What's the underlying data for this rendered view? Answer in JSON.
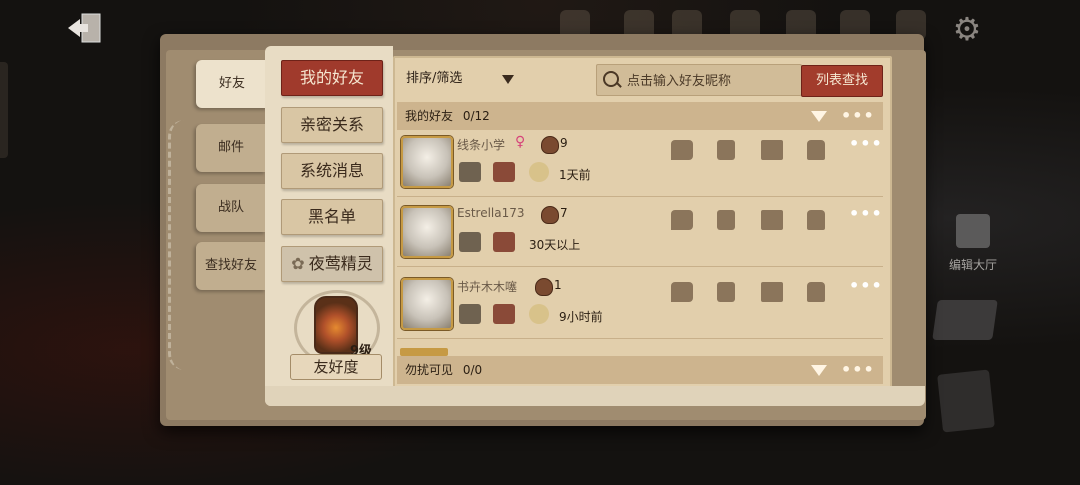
{
  "side_tabs": [
    {
      "label": "好友",
      "active": true
    },
    {
      "label": "邮件",
      "active": false
    },
    {
      "label": "战队",
      "active": false
    },
    {
      "label": "查找好友",
      "active": false
    }
  ],
  "menu": [
    {
      "label": "我的好友",
      "active": true
    },
    {
      "label": "亲密关系",
      "active": false
    },
    {
      "label": "系统消息",
      "active": false
    },
    {
      "label": "黑名单",
      "active": false
    },
    {
      "label": "夜莺精灵",
      "active": false
    }
  ],
  "friendliness": {
    "level": "9级",
    "label": "友好度"
  },
  "toolbar": {
    "sort_label": "排序/筛选",
    "search_placeholder": "点击输入好友昵称",
    "find_label": "列表查找"
  },
  "sections": [
    {
      "label": "我的好友",
      "count": "0/12",
      "more": "•••"
    },
    {
      "label": "勿扰可见",
      "count": "0/0",
      "more": "•••"
    }
  ],
  "friends": [
    {
      "name": "线条小学",
      "gender": "♀",
      "friendliness": "9",
      "status": "1天前"
    },
    {
      "name": "Estrella173",
      "gender": "",
      "friendliness": "7",
      "status": "30天以上"
    },
    {
      "name": "书卉木木噻",
      "gender": "",
      "friendliness": "1",
      "status": "9小时前"
    }
  ],
  "row_more": "•••",
  "lobby_label": "编辑大厅",
  "colors": {
    "accent_red": "#a23c2c",
    "paper": "#e2cfac",
    "header_bar": "#cdb48e"
  }
}
